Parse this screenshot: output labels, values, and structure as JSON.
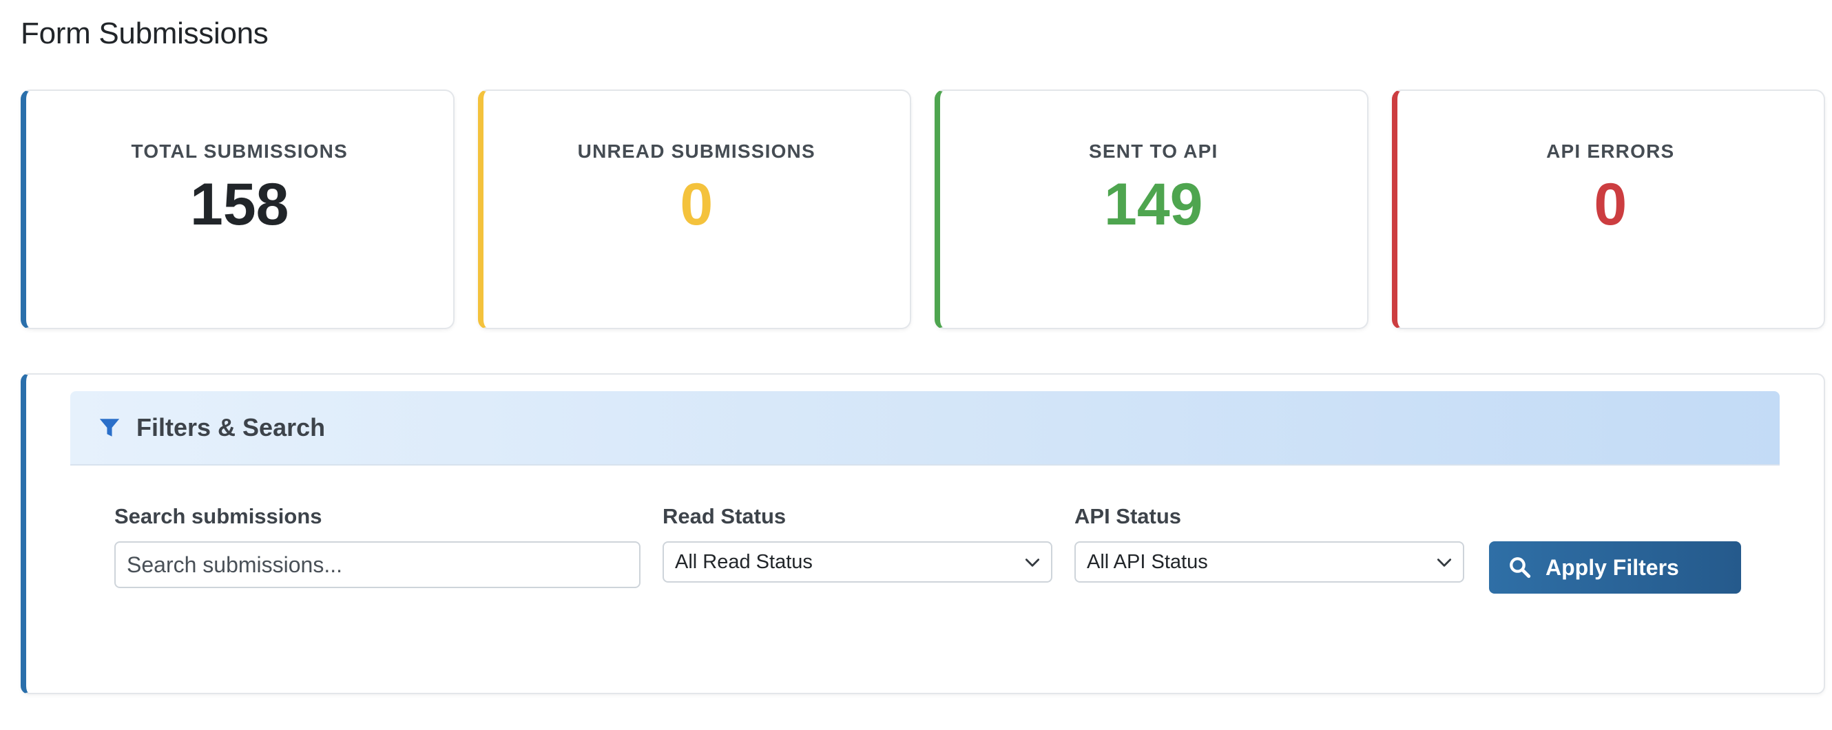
{
  "page": {
    "title": "Form Submissions"
  },
  "stats": [
    {
      "label": "TOTAL SUBMISSIONS",
      "value": "158",
      "accent": "#2a6fab",
      "value_color": "#212529"
    },
    {
      "label": "UNREAD SUBMISSIONS",
      "value": "0",
      "accent": "#f4c23c",
      "value_color": "#f4c23c"
    },
    {
      "label": "SENT TO API",
      "value": "149",
      "accent": "#4ea54f",
      "value_color": "#4ea54f"
    },
    {
      "label": "API ERRORS",
      "value": "0",
      "accent": "#cc3d40",
      "value_color": "#cc3d40"
    }
  ],
  "filters": {
    "title": "Filters & Search",
    "icon": "funnel-icon",
    "search": {
      "label": "Search submissions",
      "placeholder": "Search submissions..."
    },
    "read_status": {
      "label": "Read Status",
      "selected": "All Read Status"
    },
    "api_status": {
      "label": "API Status",
      "selected": "All API Status"
    },
    "apply_label": "Apply Filters"
  }
}
